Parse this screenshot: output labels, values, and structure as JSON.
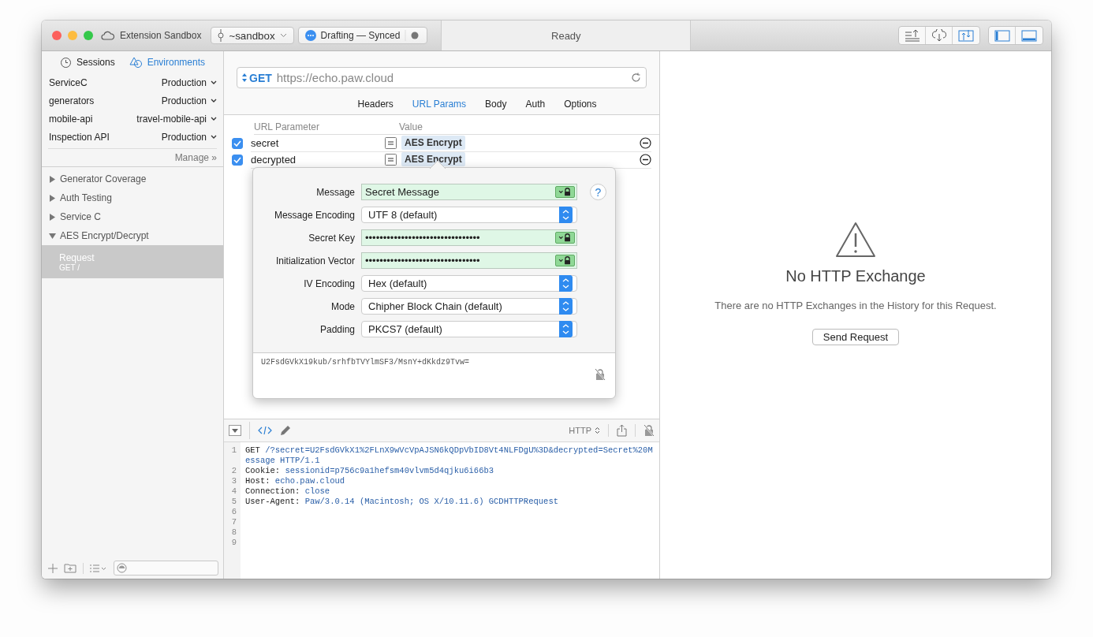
{
  "window": {
    "title": "Extension Sandbox",
    "branch": "~sandbox",
    "status": "Drafting — Synced",
    "activity": "Ready"
  },
  "sidebar": {
    "tabs": [
      {
        "label": "Sessions",
        "selected": false
      },
      {
        "label": "Environments",
        "selected": true
      }
    ],
    "environments": [
      {
        "name": "ServiceC",
        "value": "Production"
      },
      {
        "name": "generators",
        "value": "Production"
      },
      {
        "name": "mobile-api",
        "value": "travel-mobile-api"
      },
      {
        "name": "Inspection API",
        "value": "Production"
      }
    ],
    "manage": "Manage »",
    "tree": [
      {
        "label": "Generator Coverage",
        "expanded": false
      },
      {
        "label": "Auth Testing",
        "expanded": false
      },
      {
        "label": "Service C",
        "expanded": false
      },
      {
        "label": "AES Encrypt/Decrypt",
        "expanded": true,
        "children": [
          {
            "label": "Request",
            "method": "GET /",
            "selected": true
          }
        ]
      }
    ]
  },
  "request": {
    "method": "GET",
    "url": "https://echo.paw.cloud",
    "tabs": [
      {
        "label": "Headers",
        "selected": false
      },
      {
        "label": "URL Params",
        "selected": true
      },
      {
        "label": "Body",
        "selected": false
      },
      {
        "label": "Auth",
        "selected": false
      },
      {
        "label": "Options",
        "selected": false
      }
    ],
    "params": {
      "columns": [
        "URL Parameter",
        "Value"
      ],
      "rows": [
        {
          "enabled": true,
          "name": "secret",
          "value": "AES Encrypt"
        },
        {
          "enabled": true,
          "name": "decrypted",
          "value": "AES Encrypt"
        }
      ]
    }
  },
  "popover": {
    "fields": [
      {
        "kind": "text",
        "label": "Message",
        "value": "Secret Message",
        "help": "?"
      },
      {
        "kind": "select",
        "label": "Message Encoding",
        "value": "UTF 8 (default)"
      },
      {
        "kind": "text",
        "label": "Secret Key",
        "value": "••••••••••••••••••••••••••••••••"
      },
      {
        "kind": "text",
        "label": "Initialization Vector",
        "value": "••••••••••••••••••••••••••••••••"
      },
      {
        "kind": "select",
        "label": "IV Encoding",
        "value": "Hex (default)"
      },
      {
        "kind": "select",
        "label": "Mode",
        "value": "Chipher Block Chain (default)"
      },
      {
        "kind": "select",
        "label": "Padding",
        "value": "PKCS7 (default)"
      }
    ],
    "output": "U2FsdGVkX19kub/srhfbTVYlmSF3/MsnY+dKkdz9Tvw="
  },
  "editor": {
    "format": "HTTP",
    "lines": [
      {
        "number": "1",
        "key": "GET",
        "value": "/?secret=U2FsdGVkX1%2FLnX9wVcVpAJSN6kQDpVbID8Vt4NLFDgU%3D&decrypted=Secret%20Message HTTP/1.1"
      },
      {
        "number": "2",
        "key": "Cookie:",
        "value": "sessionid=p756c9a1hefsm40vlvm5d4qjku6i66b3"
      },
      {
        "number": "3",
        "key": "Host:",
        "value": "echo.paw.cloud"
      },
      {
        "number": "4",
        "key": "Connection:",
        "value": "close"
      },
      {
        "number": "5",
        "key": "User-Agent:",
        "value": "Paw/3.0.14 (Macintosh; OS X/10.11.6) GCDHTTPRequest"
      },
      {
        "number": "6"
      },
      {
        "number": "7"
      },
      {
        "number": "8"
      },
      {
        "number": "9"
      }
    ]
  },
  "response": {
    "title": "No HTTP Exchange",
    "message": "There are no HTTP Exchanges in the History for this Request.",
    "button": "Send Request"
  }
}
